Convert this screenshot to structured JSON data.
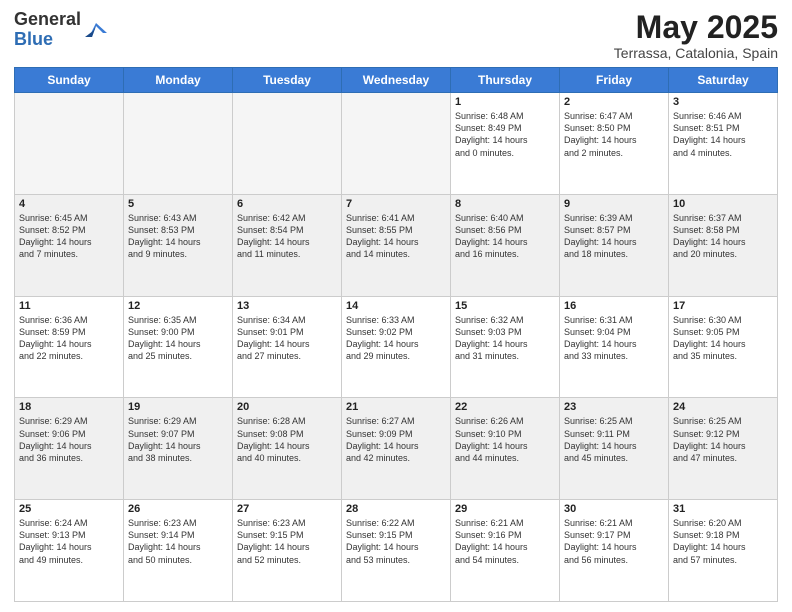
{
  "header": {
    "logo_general": "General",
    "logo_blue": "Blue",
    "month_title": "May 2025",
    "location": "Terrassa, Catalonia, Spain"
  },
  "days_of_week": [
    "Sunday",
    "Monday",
    "Tuesday",
    "Wednesday",
    "Thursday",
    "Friday",
    "Saturday"
  ],
  "weeks": [
    [
      {
        "day": "",
        "info": ""
      },
      {
        "day": "",
        "info": ""
      },
      {
        "day": "",
        "info": ""
      },
      {
        "day": "",
        "info": ""
      },
      {
        "day": "1",
        "info": "Sunrise: 6:48 AM\nSunset: 8:49 PM\nDaylight: 14 hours\nand 0 minutes."
      },
      {
        "day": "2",
        "info": "Sunrise: 6:47 AM\nSunset: 8:50 PM\nDaylight: 14 hours\nand 2 minutes."
      },
      {
        "day": "3",
        "info": "Sunrise: 6:46 AM\nSunset: 8:51 PM\nDaylight: 14 hours\nand 4 minutes."
      }
    ],
    [
      {
        "day": "4",
        "info": "Sunrise: 6:45 AM\nSunset: 8:52 PM\nDaylight: 14 hours\nand 7 minutes."
      },
      {
        "day": "5",
        "info": "Sunrise: 6:43 AM\nSunset: 8:53 PM\nDaylight: 14 hours\nand 9 minutes."
      },
      {
        "day": "6",
        "info": "Sunrise: 6:42 AM\nSunset: 8:54 PM\nDaylight: 14 hours\nand 11 minutes."
      },
      {
        "day": "7",
        "info": "Sunrise: 6:41 AM\nSunset: 8:55 PM\nDaylight: 14 hours\nand 14 minutes."
      },
      {
        "day": "8",
        "info": "Sunrise: 6:40 AM\nSunset: 8:56 PM\nDaylight: 14 hours\nand 16 minutes."
      },
      {
        "day": "9",
        "info": "Sunrise: 6:39 AM\nSunset: 8:57 PM\nDaylight: 14 hours\nand 18 minutes."
      },
      {
        "day": "10",
        "info": "Sunrise: 6:37 AM\nSunset: 8:58 PM\nDaylight: 14 hours\nand 20 minutes."
      }
    ],
    [
      {
        "day": "11",
        "info": "Sunrise: 6:36 AM\nSunset: 8:59 PM\nDaylight: 14 hours\nand 22 minutes."
      },
      {
        "day": "12",
        "info": "Sunrise: 6:35 AM\nSunset: 9:00 PM\nDaylight: 14 hours\nand 25 minutes."
      },
      {
        "day": "13",
        "info": "Sunrise: 6:34 AM\nSunset: 9:01 PM\nDaylight: 14 hours\nand 27 minutes."
      },
      {
        "day": "14",
        "info": "Sunrise: 6:33 AM\nSunset: 9:02 PM\nDaylight: 14 hours\nand 29 minutes."
      },
      {
        "day": "15",
        "info": "Sunrise: 6:32 AM\nSunset: 9:03 PM\nDaylight: 14 hours\nand 31 minutes."
      },
      {
        "day": "16",
        "info": "Sunrise: 6:31 AM\nSunset: 9:04 PM\nDaylight: 14 hours\nand 33 minutes."
      },
      {
        "day": "17",
        "info": "Sunrise: 6:30 AM\nSunset: 9:05 PM\nDaylight: 14 hours\nand 35 minutes."
      }
    ],
    [
      {
        "day": "18",
        "info": "Sunrise: 6:29 AM\nSunset: 9:06 PM\nDaylight: 14 hours\nand 36 minutes."
      },
      {
        "day": "19",
        "info": "Sunrise: 6:29 AM\nSunset: 9:07 PM\nDaylight: 14 hours\nand 38 minutes."
      },
      {
        "day": "20",
        "info": "Sunrise: 6:28 AM\nSunset: 9:08 PM\nDaylight: 14 hours\nand 40 minutes."
      },
      {
        "day": "21",
        "info": "Sunrise: 6:27 AM\nSunset: 9:09 PM\nDaylight: 14 hours\nand 42 minutes."
      },
      {
        "day": "22",
        "info": "Sunrise: 6:26 AM\nSunset: 9:10 PM\nDaylight: 14 hours\nand 44 minutes."
      },
      {
        "day": "23",
        "info": "Sunrise: 6:25 AM\nSunset: 9:11 PM\nDaylight: 14 hours\nand 45 minutes."
      },
      {
        "day": "24",
        "info": "Sunrise: 6:25 AM\nSunset: 9:12 PM\nDaylight: 14 hours\nand 47 minutes."
      }
    ],
    [
      {
        "day": "25",
        "info": "Sunrise: 6:24 AM\nSunset: 9:13 PM\nDaylight: 14 hours\nand 49 minutes."
      },
      {
        "day": "26",
        "info": "Sunrise: 6:23 AM\nSunset: 9:14 PM\nDaylight: 14 hours\nand 50 minutes."
      },
      {
        "day": "27",
        "info": "Sunrise: 6:23 AM\nSunset: 9:15 PM\nDaylight: 14 hours\nand 52 minutes."
      },
      {
        "day": "28",
        "info": "Sunrise: 6:22 AM\nSunset: 9:15 PM\nDaylight: 14 hours\nand 53 minutes."
      },
      {
        "day": "29",
        "info": "Sunrise: 6:21 AM\nSunset: 9:16 PM\nDaylight: 14 hours\nand 54 minutes."
      },
      {
        "day": "30",
        "info": "Sunrise: 6:21 AM\nSunset: 9:17 PM\nDaylight: 14 hours\nand 56 minutes."
      },
      {
        "day": "31",
        "info": "Sunrise: 6:20 AM\nSunset: 9:18 PM\nDaylight: 14 hours\nand 57 minutes."
      }
    ]
  ]
}
